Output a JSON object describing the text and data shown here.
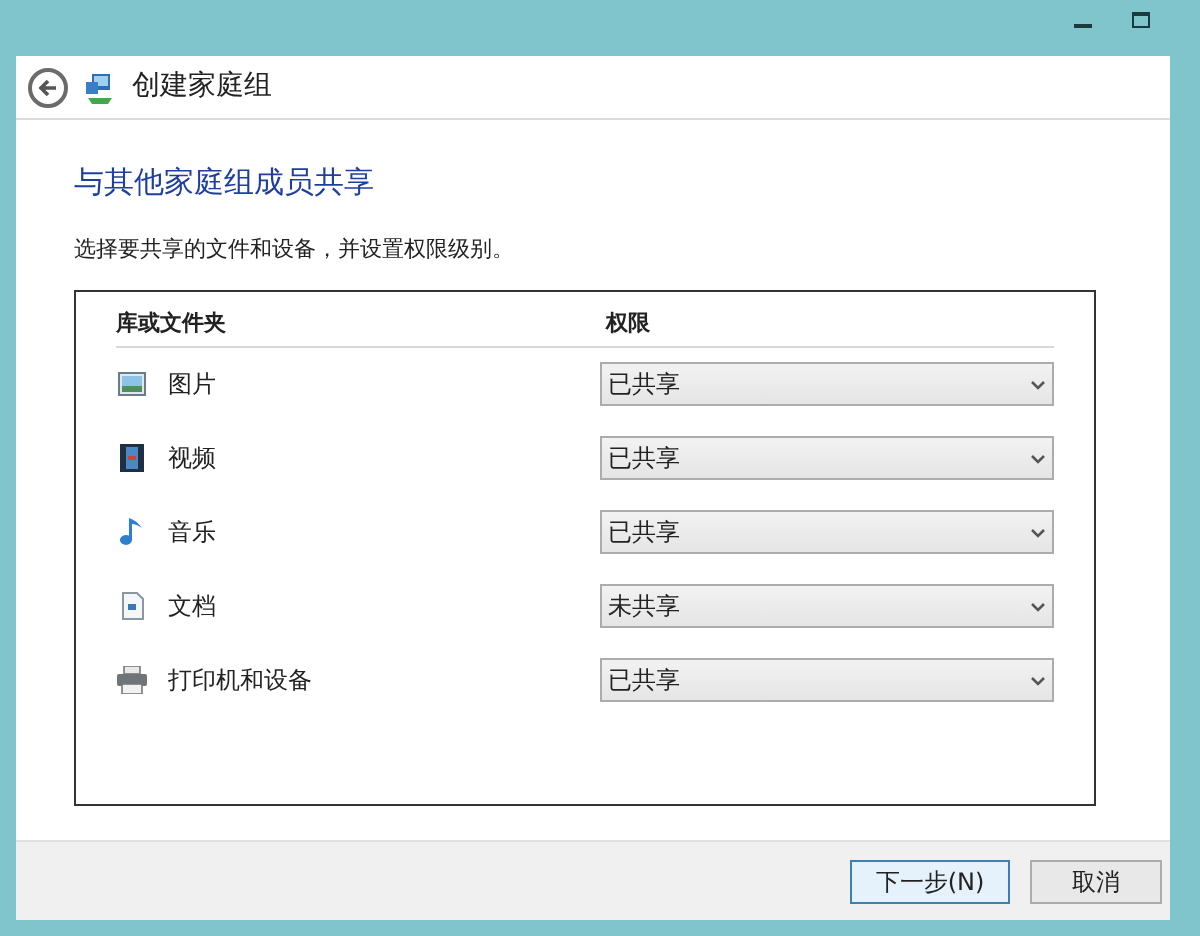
{
  "window": {
    "title": "创建家庭组"
  },
  "heading": "与其他家庭组成员共享",
  "instruction": "选择要共享的文件和设备，并设置权限级别。",
  "table": {
    "columns": [
      "库或文件夹",
      "权限"
    ],
    "rows": [
      {
        "kind": "pictures",
        "name": "图片",
        "permission": "已共享"
      },
      {
        "kind": "videos",
        "name": "视频",
        "permission": "已共享"
      },
      {
        "kind": "music",
        "name": "音乐",
        "permission": "已共享"
      },
      {
        "kind": "documents",
        "name": "文档",
        "permission": "未共享"
      },
      {
        "kind": "printers",
        "name": "打印机和设备",
        "permission": "已共享"
      }
    ]
  },
  "buttons": [
    {
      "label": "下一步(N)",
      "selected": true
    },
    {
      "label": "取消",
      "selected": false
    }
  ]
}
